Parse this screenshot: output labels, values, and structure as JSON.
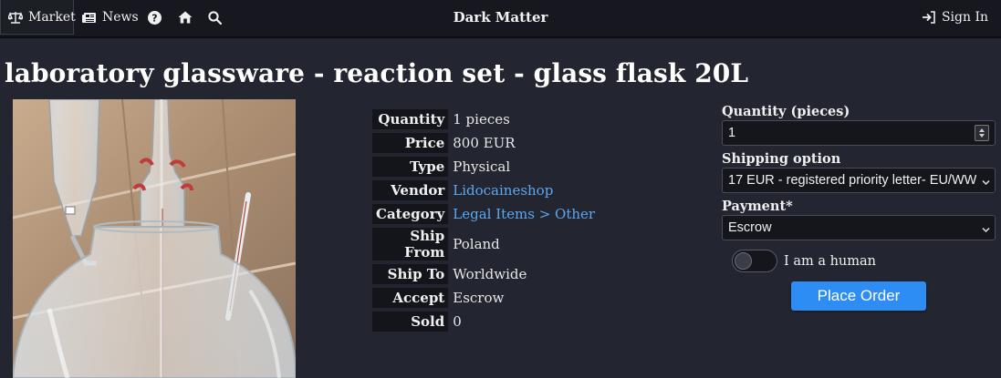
{
  "nav": {
    "market_label": "Market",
    "market_icon": "scale-icon",
    "news_label": "News",
    "news_icon": "newspaper-icon",
    "help_icon": "question-circle-icon",
    "home_icon": "home-icon",
    "search_icon": "search-icon",
    "site_title": "Dark Matter",
    "signin_label": "Sign In",
    "signin_icon": "sign-in-icon"
  },
  "product": {
    "title": "laboratory glassware - reaction set - glass flask 20L",
    "image_alt": "product-photo"
  },
  "details": {
    "rows": [
      {
        "key": "Quantity",
        "value": "1 pieces"
      },
      {
        "key": "Price",
        "value": "800 EUR"
      },
      {
        "key": "Type",
        "value": "Physical"
      },
      {
        "key": "Vendor",
        "value": "Lidocaineshop"
      },
      {
        "key": "Category",
        "value": "Legal Items > Other"
      },
      {
        "key": "Ship From",
        "value": "Poland"
      },
      {
        "key": "Ship To",
        "value": "Worldwide"
      },
      {
        "key": "Accept",
        "value": "Escrow"
      },
      {
        "key": "Sold",
        "value": "0"
      }
    ]
  },
  "order_form": {
    "quantity_label": "Quantity (pieces)",
    "quantity_value": "1",
    "shipping_label": "Shipping option",
    "shipping_value": "17 EUR - registered priority letter- EU/WW",
    "payment_label": "Payment*",
    "payment_value": "Escrow",
    "human_label": "I am a human",
    "human_checked": false,
    "submit_label": "Place Order"
  },
  "colors": {
    "background": "#232530",
    "nav_background": "#17181f",
    "link": "#5ea8f0",
    "button": "#2e8cf5"
  }
}
